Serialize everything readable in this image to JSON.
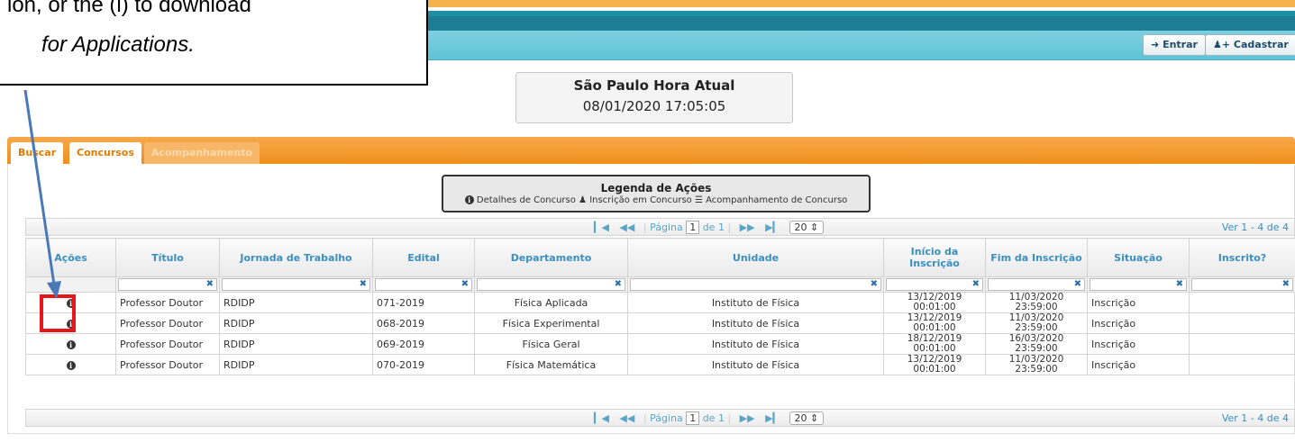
{
  "callout": {
    "line1": "ion, or the (i) to download",
    "line2": "for Applications."
  },
  "nav": {
    "login_label": "Entrar",
    "register_label": "Cadastrar"
  },
  "clock": {
    "title": "São Paulo Hora Atual",
    "datetime": "08/01/2020 17:05:05"
  },
  "tabs": [
    {
      "label": "Buscar"
    },
    {
      "label": "Concursos"
    },
    {
      "label": "Acompanhamento"
    }
  ],
  "legend": {
    "title": "Legenda de Ações",
    "details": "Detalhes de Concurso",
    "subscribe": "Inscrição em Concurso",
    "tracking": "Acompanhamento de Concurso"
  },
  "pager": {
    "page_label": "Página",
    "page": "1",
    "of_label": "de 1",
    "per_page": "20",
    "range": "Ver 1 - 4 de 4"
  },
  "table": {
    "headers": [
      "Ações",
      "Título",
      "Jornada de Trabalho",
      "Edital",
      "Departamento",
      "Unidade",
      "Início da Inscrição",
      "Fim da Inscrição",
      "Situação",
      "Inscrito?"
    ],
    "rows": [
      {
        "titulo": "Professor Doutor",
        "jornada": "RDIDP",
        "edital": "071-2019",
        "departamento": "Física Aplicada",
        "unidade": "Instituto de Física",
        "inicio_d": "13/12/2019",
        "inicio_t": "00:01:00",
        "fim_d": "11/03/2020",
        "fim_t": "23:59:00",
        "situacao": "Inscrição",
        "inscrito": ""
      },
      {
        "titulo": "Professor Doutor",
        "jornada": "RDIDP",
        "edital": "068-2019",
        "departamento": "Física Experimental",
        "unidade": "Instituto de Física",
        "inicio_d": "13/12/2019",
        "inicio_t": "00:01:00",
        "fim_d": "11/03/2020",
        "fim_t": "23:59:00",
        "situacao": "Inscrição",
        "inscrito": ""
      },
      {
        "titulo": "Professor Doutor",
        "jornada": "RDIDP",
        "edital": "069-2019",
        "departamento": "Física Geral",
        "unidade": "Instituto de Física",
        "inicio_d": "18/12/2019",
        "inicio_t": "00:01:00",
        "fim_d": "16/03/2020",
        "fim_t": "23:59:00",
        "situacao": "Inscrição",
        "inscrito": ""
      },
      {
        "titulo": "Professor Doutor",
        "jornada": "RDIDP",
        "edital": "070-2019",
        "departamento": "Física Matemática",
        "unidade": "Instituto de Física",
        "inicio_d": "13/12/2019",
        "inicio_t": "00:01:00",
        "fim_d": "11/03/2020",
        "fim_t": "23:59:00",
        "situacao": "Inscrição",
        "inscrito": ""
      }
    ]
  },
  "colors": {
    "accent_orange": "#f08f1c",
    "header_teal": "#1c7e92",
    "link_blue": "#3a8ec0",
    "highlight_red": "#e8161b"
  },
  "icons": {
    "info": "info-icon",
    "login": "login-icon",
    "register": "user-plus-icon",
    "first": "first-page-icon",
    "prev": "prev-page-icon",
    "next": "next-page-icon",
    "last": "last-page-icon",
    "clear": "clear-filter-icon"
  }
}
